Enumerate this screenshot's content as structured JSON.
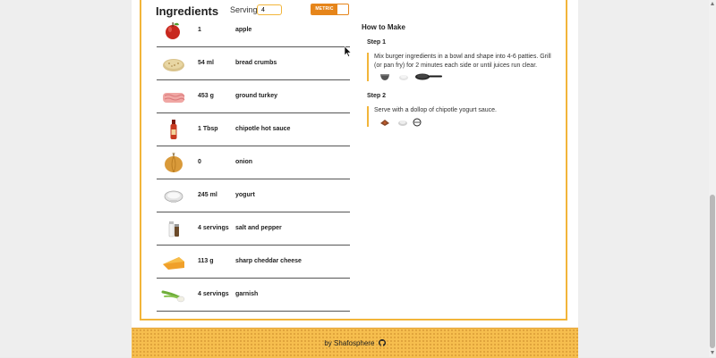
{
  "ingredients_panel": {
    "title": "Ingredients",
    "servings_label": "Servings:",
    "servings_value": "4",
    "units_toggle_label": "METRIC",
    "items": [
      {
        "qty": "1",
        "name": "apple",
        "icon": "apple-icon"
      },
      {
        "qty": "54 ml",
        "name": "bread crumbs",
        "icon": "bread-crumbs-icon"
      },
      {
        "qty": "453 g",
        "name": "ground turkey",
        "icon": "ground-turkey-icon"
      },
      {
        "qty": "1 Tbsp",
        "name": "chipotle hot sauce",
        "icon": "hot-sauce-icon"
      },
      {
        "qty": "0",
        "name": "onion",
        "icon": "onion-icon"
      },
      {
        "qty": "245 ml",
        "name": "yogurt",
        "icon": "yogurt-icon"
      },
      {
        "qty": "4 servings",
        "name": "salt and pepper",
        "icon": "salt-and-pepper-icon"
      },
      {
        "qty": "113 g",
        "name": "sharp cheddar cheese",
        "icon": "cheddar-cheese-icon"
      },
      {
        "qty": "4 servings",
        "name": "garnish",
        "icon": "garnish-icon"
      }
    ]
  },
  "how_to_make": {
    "title": "How to Make",
    "steps": [
      {
        "title": "Step 1",
        "text": "Mix burger ingredients in a bowl and shape into 4-6 patties. Grill (or pan fry) for 2 minutes each side or until juices run clear.",
        "tools": [
          "bowl-icon",
          "bread-crumbs-icon",
          "frying-pan-icon"
        ]
      },
      {
        "title": "Step 2",
        "text": "Serve with a dollop of chipotle yogurt sauce.",
        "tools": [
          "hot-sauce-icon",
          "yogurt-icon",
          "bowl-icon"
        ]
      }
    ]
  },
  "footer": {
    "text": "by Shafosphere",
    "icon": "github-icon"
  },
  "colors": {
    "accent": "#f2b53a",
    "toggle": "#e6851a",
    "footer": "#f6be4e",
    "row_divider": "#555555"
  }
}
